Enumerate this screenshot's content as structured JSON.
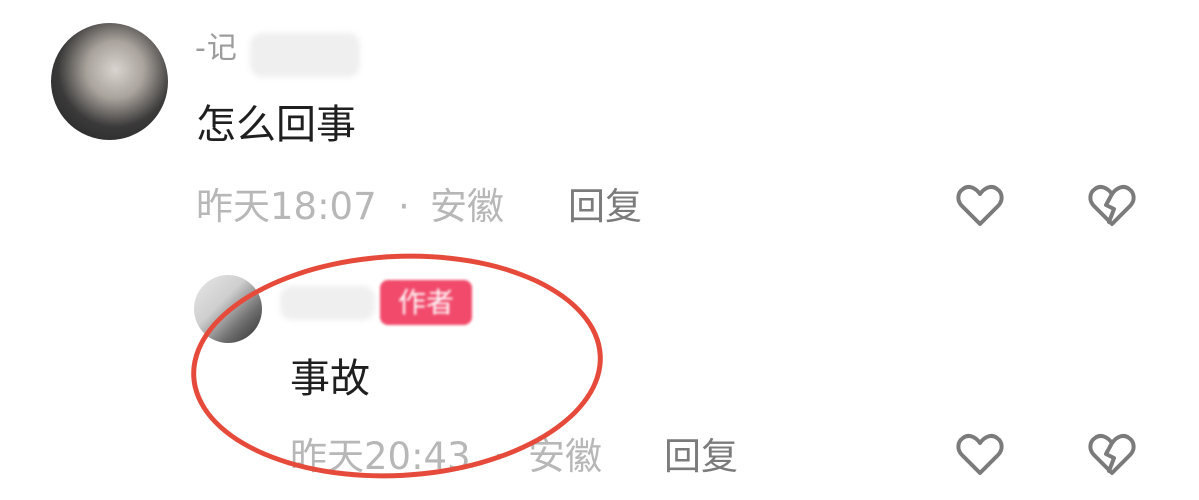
{
  "comments": [
    {
      "username": "-记",
      "text": "怎么回事",
      "time": "昨天18:07",
      "location": "安徽",
      "reply_label": "回复"
    },
    {
      "badge": "作者",
      "text": "事故",
      "time": "昨天20:43",
      "location": "安徽",
      "reply_label": "回复"
    }
  ],
  "separator": "·",
  "icons": {
    "like": "heart-outline",
    "dislike": "broken-heart-outline"
  },
  "colors": {
    "highlight_circle": "#e64a3a",
    "author_badge": "#f14a6b",
    "icon": "#7b7b7b"
  }
}
